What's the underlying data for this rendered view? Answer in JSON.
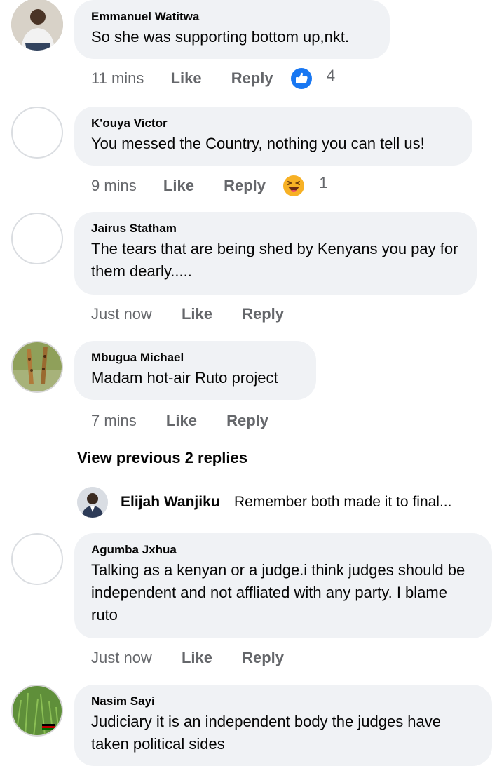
{
  "actions": {
    "like": "Like",
    "reply": "Reply"
  },
  "comments": [
    {
      "author": "Emmanuel Watitwa",
      "text": "So she was supporting bottom up,nkt.",
      "time": "11 mins",
      "reaction_icon": "like-reaction-icon",
      "reaction_count": "4"
    },
    {
      "author": "K'ouya Victor",
      "text": "You messed the Country, nothing you can tell us!",
      "time": "9 mins",
      "reaction_icon": "laughing-emoji-icon",
      "reaction_count": "1"
    },
    {
      "author": "Jairus Statham",
      "text": "The tears that are being shed by Kenyans you pay for them dearly.....",
      "time": "Just now"
    },
    {
      "author": "Mbugua Michael",
      "text": "Madam hot-air Ruto project",
      "time": "7 mins"
    },
    {
      "author": "Agumba Jxhua",
      "text": "Talking as a kenyan or a judge.i think judges should be independent and not affliated with any party. I blame ruto",
      "time": "Just now"
    },
    {
      "author": "Nasim Sayi",
      "text": "Judiciary it is an independent body the judges have taken political sides"
    }
  ],
  "view_previous": "View previous 2 replies",
  "reply_preview": {
    "author": "Elijah Wanjiku",
    "text": "Remember both made it to final..."
  },
  "colors": {
    "bubble": "#f0f2f5",
    "meta": "#65676b",
    "like_blue": "#1877f2"
  }
}
